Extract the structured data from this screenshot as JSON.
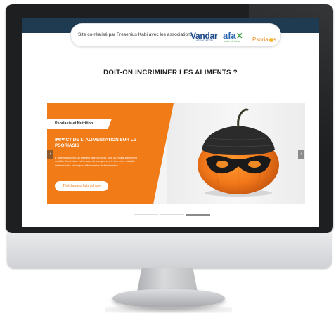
{
  "header": {
    "partner_text": "Site co-réalisé par Fresenius Kabi avec les associations",
    "logos": {
      "vandar_main": "Vandar",
      "vandar_sub": "ASSOCIATION",
      "afa_main": "afa",
      "afa_sub": "crohn rch france",
      "psoriasis_main": "Psoria"
    }
  },
  "page_title": "DOIT-ON INCRIMINER LES ALIMENTS ?",
  "slide": {
    "ribbon": "Psoriasis et Nutrition",
    "heading": "IMPACT DE L' ALIMENTATION SUR LE PSORIASIS",
    "body": "L' alimentation est un élément que l'on peut, plus ou moins facilement modifier. Il est donc intéressant de comprendre le lien entre maladie inflammatoire chronique, inflammation et alimentation.",
    "cta": "Téléchargez la brochure",
    "prev_glyph": "‹",
    "next_glyph": "›",
    "image": "pumpkin-wearing-mask-and-beanie"
  },
  "carousel": {
    "count": 3,
    "active_index": 2
  },
  "colors": {
    "brand_orange": "#f07b17",
    "topbar_navy": "#1e3b52"
  }
}
